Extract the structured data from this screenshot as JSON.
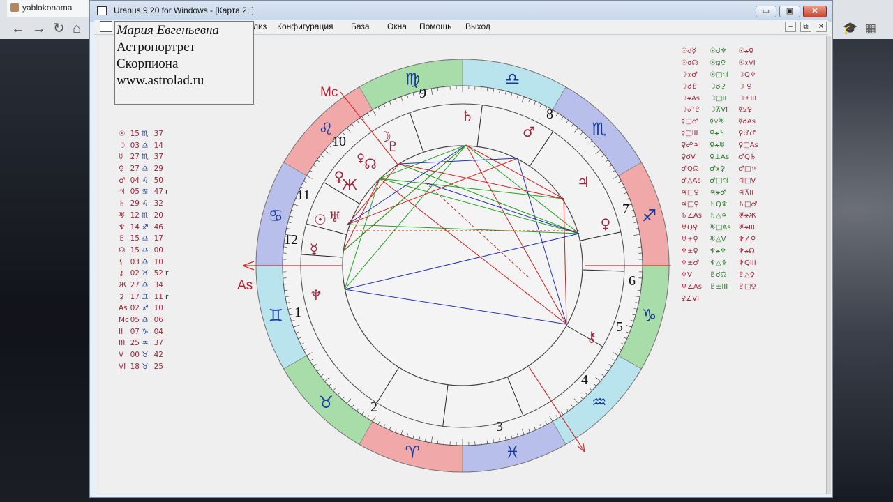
{
  "browser": {
    "tab_label": "yablokonama",
    "back_icon": "arrow-left-icon",
    "forward_icon": "arrow-right-icon",
    "reload_icon": "reload-icon",
    "home_icon": "home-icon"
  },
  "window": {
    "title": "Uranus 9.20 for Windows - [Карта 2: ]",
    "minimize_label": "▭",
    "maximize_label": "▣",
    "close_label": "✕"
  },
  "menu": {
    "analysis": "лиз",
    "config": "Конфигурация",
    "base": "База",
    "windows": "Окна",
    "help": "Помощь",
    "exit": "Выход",
    "mdi_min": "–",
    "mdi_restore": "⧉",
    "mdi_close": "✕"
  },
  "namebox": {
    "name": "Мария Евгеньевна",
    "line1": "Астропортрет",
    "line2": "Скорпиона",
    "line3": "www.astrolad.ru"
  },
  "planets": [
    {
      "g": "☉",
      "deg": "15",
      "sign": "♏",
      "min": "37",
      "r": ""
    },
    {
      "g": "☽",
      "deg": "03",
      "sign": "♎",
      "min": "14",
      "r": ""
    },
    {
      "g": "☿",
      "deg": "27",
      "sign": "♏",
      "min": "37",
      "r": ""
    },
    {
      "g": "♀",
      "deg": "27",
      "sign": "♎",
      "min": "29",
      "r": ""
    },
    {
      "g": "♂",
      "deg": "04",
      "sign": "♌",
      "min": "50",
      "r": ""
    },
    {
      "g": "♃",
      "deg": "05",
      "sign": "♋",
      "min": "47",
      "r": "r"
    },
    {
      "g": "♄",
      "deg": "29",
      "sign": "♌",
      "min": "32",
      "r": ""
    },
    {
      "g": "♅",
      "deg": "12",
      "sign": "♏",
      "min": "20",
      "r": ""
    },
    {
      "g": "♆",
      "deg": "14",
      "sign": "♐",
      "min": "46",
      "r": ""
    },
    {
      "g": "♇",
      "deg": "15",
      "sign": "♎",
      "min": "17",
      "r": ""
    },
    {
      "g": "☊",
      "deg": "15",
      "sign": "♎",
      "min": "00",
      "r": ""
    },
    {
      "g": "⚸",
      "deg": "03",
      "sign": "♎",
      "min": "10",
      "r": ""
    },
    {
      "g": "⚷",
      "deg": "02",
      "sign": "♉",
      "min": "52",
      "r": "r"
    },
    {
      "g": "Ж",
      "deg": "27",
      "sign": "♎",
      "min": "34",
      "r": ""
    },
    {
      "g": "⚳",
      "deg": "17",
      "sign": "♊",
      "min": "11",
      "r": "r"
    },
    {
      "g": "As",
      "deg": "02",
      "sign": "♐",
      "min": "10",
      "r": ""
    },
    {
      "g": "Mc",
      "deg": "05",
      "sign": "♎",
      "min": "06",
      "r": ""
    },
    {
      "g": "II",
      "deg": "07",
      "sign": "♑",
      "min": "04",
      "r": ""
    },
    {
      "g": "III",
      "deg": "25",
      "sign": "♒",
      "min": "37",
      "r": ""
    },
    {
      "g": "V",
      "deg": "00",
      "sign": "♉",
      "min": "42",
      "r": ""
    },
    {
      "g": "VI",
      "deg": "18",
      "sign": "♉",
      "min": "25",
      "r": ""
    }
  ],
  "aspects": [
    [
      "☉☌☿",
      "☉☌♆",
      "☉⚹♀"
    ],
    [
      "☉☌☊",
      "☉⚼♀",
      "☉⚹VI"
    ],
    [
      "☽⚹♂",
      "☉□♃",
      "☽Q♆"
    ],
    [
      "☽☌♇",
      "☽☌⚳",
      "☽ ♀"
    ],
    [
      "☽⚹As",
      "☽□II",
      "☽±III"
    ],
    [
      "☽☍♇",
      "☽⊼VI",
      "☿⚺♀"
    ],
    [
      "☿□♂",
      "☿⚺♅",
      "☿☌As"
    ],
    [
      "☿□III",
      "♀⚹♄",
      "♀♂♂"
    ],
    [
      "♀☍♃",
      "♀⚹♅",
      "♀□As"
    ],
    [
      "♀☌V",
      "♀⊥As",
      "♂Q♄"
    ],
    [
      "♂Q☊",
      "♂⚹♀",
      "♂□♃"
    ],
    [
      "♂△As",
      "♂□♃",
      "♃□V"
    ],
    [
      "♃□♀",
      "♃⚹♂",
      "♃⊼II"
    ],
    [
      "♃□♀",
      "♄Q♆",
      "♄□♂"
    ],
    [
      "♄∠As",
      "♄△♃",
      "♅⚹Ж"
    ],
    [
      "♅Q♀",
      "♅□As",
      "♅⚹III"
    ],
    [
      "♅±♀",
      "♅△V",
      "♆∠♀"
    ],
    [
      "♆±♀",
      "♆⚹♆",
      "♆⚹☊"
    ],
    [
      "♆±♂",
      "♆△♆",
      "♆QIII"
    ],
    [
      "♆V",
      "♇☌☊",
      "♇△♀"
    ],
    [
      "♆∠As",
      "♇±III",
      "♇□♀"
    ],
    [
      "♀∠VI",
      "",
      ""
    ]
  ],
  "chart_labels": {
    "mc": "Mc",
    "as": "As",
    "house_numbers": [
      "1",
      "2",
      "3",
      "4",
      "5",
      "6",
      "7",
      "8",
      "9",
      "10",
      "11",
      "12"
    ]
  },
  "sign_ring": [
    {
      "glyph": "♍",
      "color": "#a8dca8"
    },
    {
      "glyph": "♌",
      "color": "#f0a8a8"
    },
    {
      "glyph": "♋",
      "color": "#b8bfea"
    },
    {
      "glyph": "♊",
      "color": "#b9e4ee"
    },
    {
      "glyph": "♉",
      "color": "#a8dca8"
    },
    {
      "glyph": "♈",
      "color": "#f0a8a8"
    },
    {
      "glyph": "♓",
      "color": "#b8bfea"
    },
    {
      "glyph": "♒",
      "color": "#b9e4ee"
    },
    {
      "glyph": "♑",
      "color": "#a8dca8"
    },
    {
      "glyph": "♐",
      "color": "#f0a8a8"
    },
    {
      "glyph": "♏",
      "color": "#b8bfea"
    },
    {
      "glyph": "♎",
      "color": "#b9e4ee"
    }
  ],
  "chart_planets": [
    {
      "glyph": "♄",
      "color": "#a0283c"
    },
    {
      "glyph": "♂",
      "color": "#a0283c"
    },
    {
      "glyph": "♃",
      "color": "#a0283c"
    },
    {
      "glyph": "♀",
      "color": "#a0283c"
    },
    {
      "glyph": "⚷",
      "color": "#a0283c"
    },
    {
      "glyph": "♆",
      "color": "#a0283c"
    },
    {
      "glyph": "☿",
      "color": "#a0283c"
    },
    {
      "glyph": "☉",
      "color": "#a0283c"
    },
    {
      "glyph": "♅",
      "color": "#a0283c"
    },
    {
      "glyph": "Ж",
      "color": "#a0283c"
    },
    {
      "glyph": "♀",
      "color": "#a0283c"
    },
    {
      "glyph": "☊",
      "color": "#a0283c"
    },
    {
      "glyph": "☽",
      "color": "#a0283c"
    },
    {
      "glyph": "♇",
      "color": "#a0283c"
    }
  ],
  "colors": {
    "accent": "#a0283c",
    "sign_glyph": "#1a3a9a",
    "aspect_red": "#d02020",
    "aspect_blue": "#2030b0",
    "aspect_green": "#20a020"
  }
}
